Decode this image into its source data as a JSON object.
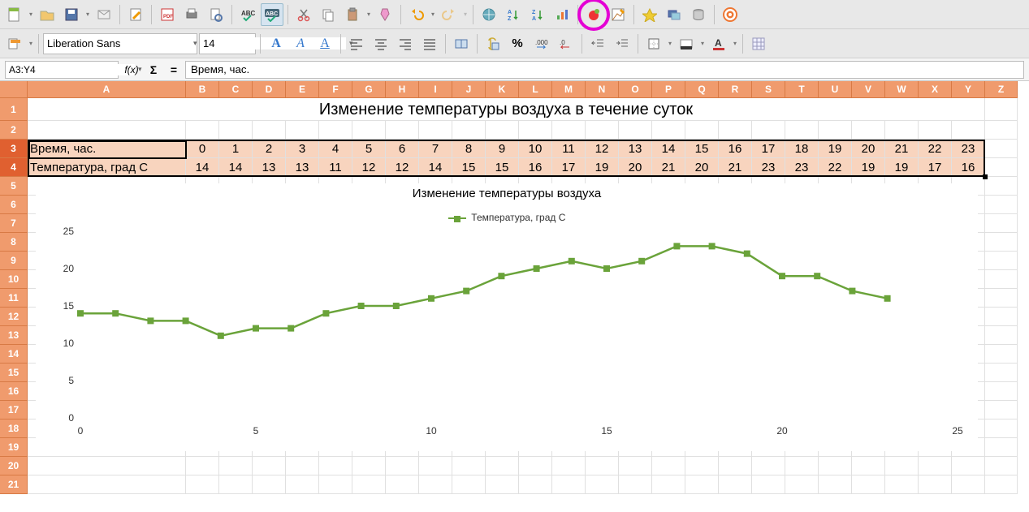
{
  "toolbar": {
    "font_name": "Liberation Sans",
    "font_size": "14"
  },
  "formula_bar": {
    "cell_ref": "A3:Y4",
    "content": "Время, час."
  },
  "columns": [
    "A",
    "B",
    "C",
    "D",
    "E",
    "F",
    "G",
    "H",
    "I",
    "J",
    "K",
    "L",
    "M",
    "N",
    "O",
    "P",
    "Q",
    "R",
    "S",
    "T",
    "U",
    "V",
    "W",
    "X",
    "Y",
    "Z"
  ],
  "rows_visible": 21,
  "sheet": {
    "title": "Изменение температуры воздуха в течение суток",
    "row3_label": "Время, час.",
    "row3_values": [
      0,
      1,
      2,
      3,
      4,
      5,
      6,
      7,
      8,
      9,
      10,
      11,
      12,
      13,
      14,
      15,
      16,
      17,
      18,
      19,
      20,
      21,
      22,
      23
    ],
    "row4_label": "Температура, град С",
    "row4_values": [
      14,
      14,
      13,
      13,
      11,
      12,
      12,
      14,
      15,
      15,
      16,
      17,
      19,
      20,
      21,
      20,
      21,
      23,
      23,
      22,
      19,
      19,
      17,
      16
    ]
  },
  "chart_data": {
    "type": "line",
    "title": "Изменение температуры воздуха",
    "legend": "Температура, град С",
    "x": [
      0,
      1,
      2,
      3,
      4,
      5,
      6,
      7,
      8,
      9,
      10,
      11,
      12,
      13,
      14,
      15,
      16,
      17,
      18,
      19,
      20,
      21,
      22,
      23
    ],
    "y": [
      14,
      14,
      13,
      13,
      11,
      12,
      12,
      14,
      15,
      15,
      16,
      17,
      19,
      20,
      21,
      20,
      21,
      23,
      23,
      22,
      19,
      19,
      17,
      16
    ],
    "xlabel": "",
    "ylabel": "",
    "xlim": [
      0,
      25
    ],
    "ylim": [
      0,
      25
    ],
    "xticks": [
      0,
      5,
      10,
      15,
      20,
      25
    ],
    "yticks": [
      0,
      5,
      10,
      15,
      20,
      25
    ]
  },
  "icons": {
    "main_row": [
      "new-doc",
      "open",
      "save",
      "mail",
      "edit-doc",
      "pdf-export",
      "print",
      "preview",
      "spellcheck",
      "auto-spellcheck",
      "cut",
      "copy",
      "paste",
      "format-paint",
      "undo",
      "redo",
      "hyperlink",
      "sort-asc",
      "sort-desc",
      "chart-btn",
      "record-macro",
      "draw-func",
      "navigator",
      "gallery",
      "data-sources",
      "help"
    ],
    "format_row": [
      "highlight-style",
      "font-color-A",
      "italic-A",
      "underline-A",
      "align-left",
      "align-center",
      "align-right",
      "justify",
      "merge-cells",
      "wrap",
      "currency",
      "percent",
      "decimal-add",
      "decimal-remove",
      "indent-decrease",
      "indent-increase",
      "borders",
      "bg-color",
      "font-color-swatch",
      "grid-toggle"
    ]
  }
}
